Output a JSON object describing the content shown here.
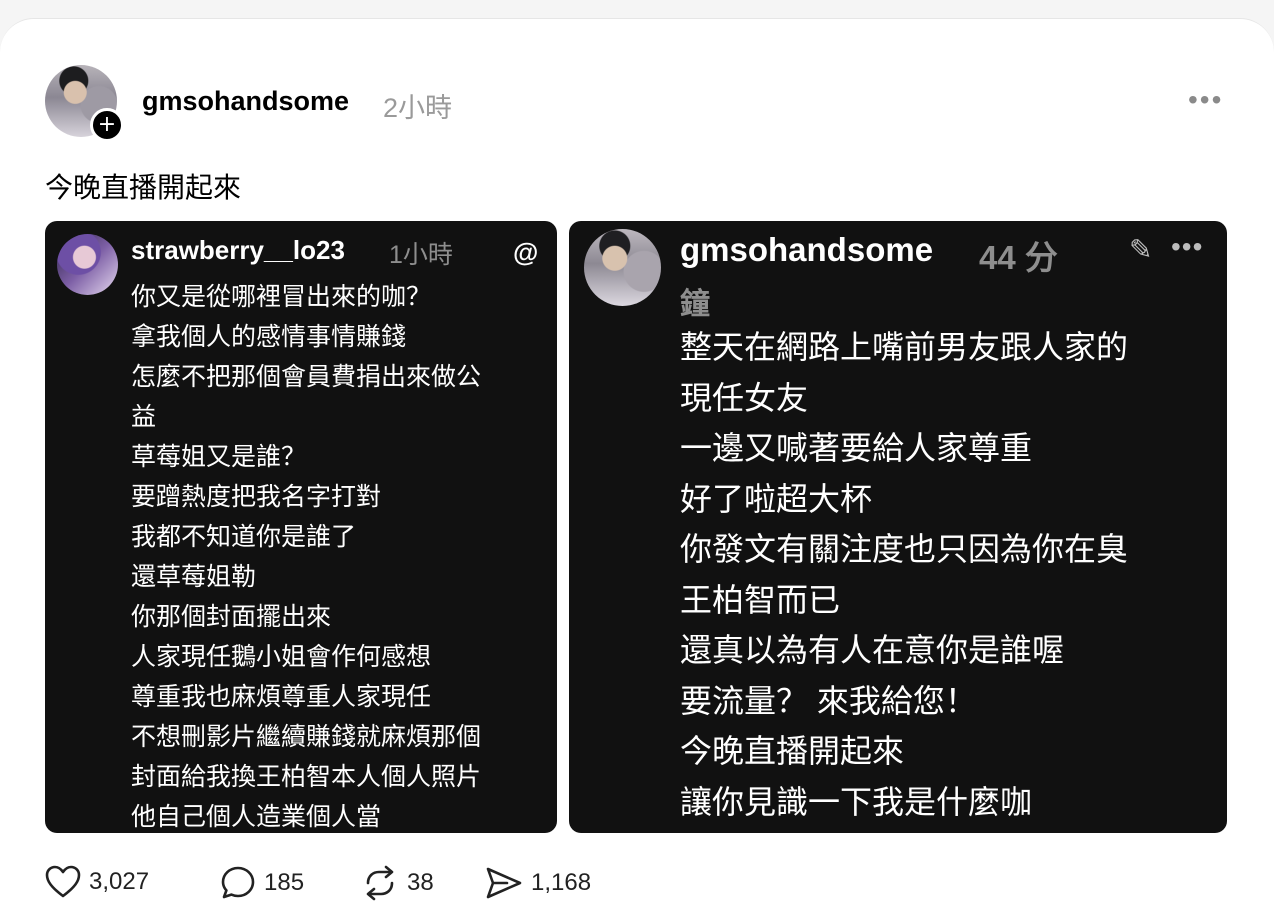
{
  "post": {
    "username": "gmsohandsome",
    "time": "2小時",
    "caption": "今晚直播開起來",
    "more_icon": "more-horizontal-icon"
  },
  "left_screenshot": {
    "username": "strawberry__lo23",
    "time": "1小時",
    "icon": "threads-icon",
    "lines": [
      "你又是從哪裡冒出來的咖？",
      "拿我個人的感情事情賺錢",
      "怎麼不把那個會員費捐出來做公",
      "益",
      "草莓姐又是誰？",
      "要蹭熱度把我名字打對",
      "我都不知道你是誰了",
      "還草莓姐勒",
      "你那個封面擺出來",
      "人家現任鵝小姐會作何感想",
      "尊重我也麻煩尊重人家現任",
      "不想刪影片繼續賺錢就麻煩那個",
      "封面給我換王柏智本人個人照片",
      "他自己個人造業個人當"
    ]
  },
  "right_screenshot": {
    "username": "gmsohandsome",
    "time_part1": "44 分",
    "time_part2": "鐘",
    "lines": [
      "整天在網路上嘴前男友跟人家的",
      "現任女友",
      "一邊又喊著要給人家尊重",
      "好了啦超大杯",
      "你發文有關注度也只因為你在臭",
      "王柏智而已",
      "還真以為有人在意你是誰喔",
      "要流量？ 來我給您！",
      "今晚直播開起來",
      "讓你見識一下我是什麼咖"
    ]
  },
  "actions": {
    "likes": "3,027",
    "comments": "185",
    "reposts": "38",
    "shares": "1,168"
  }
}
